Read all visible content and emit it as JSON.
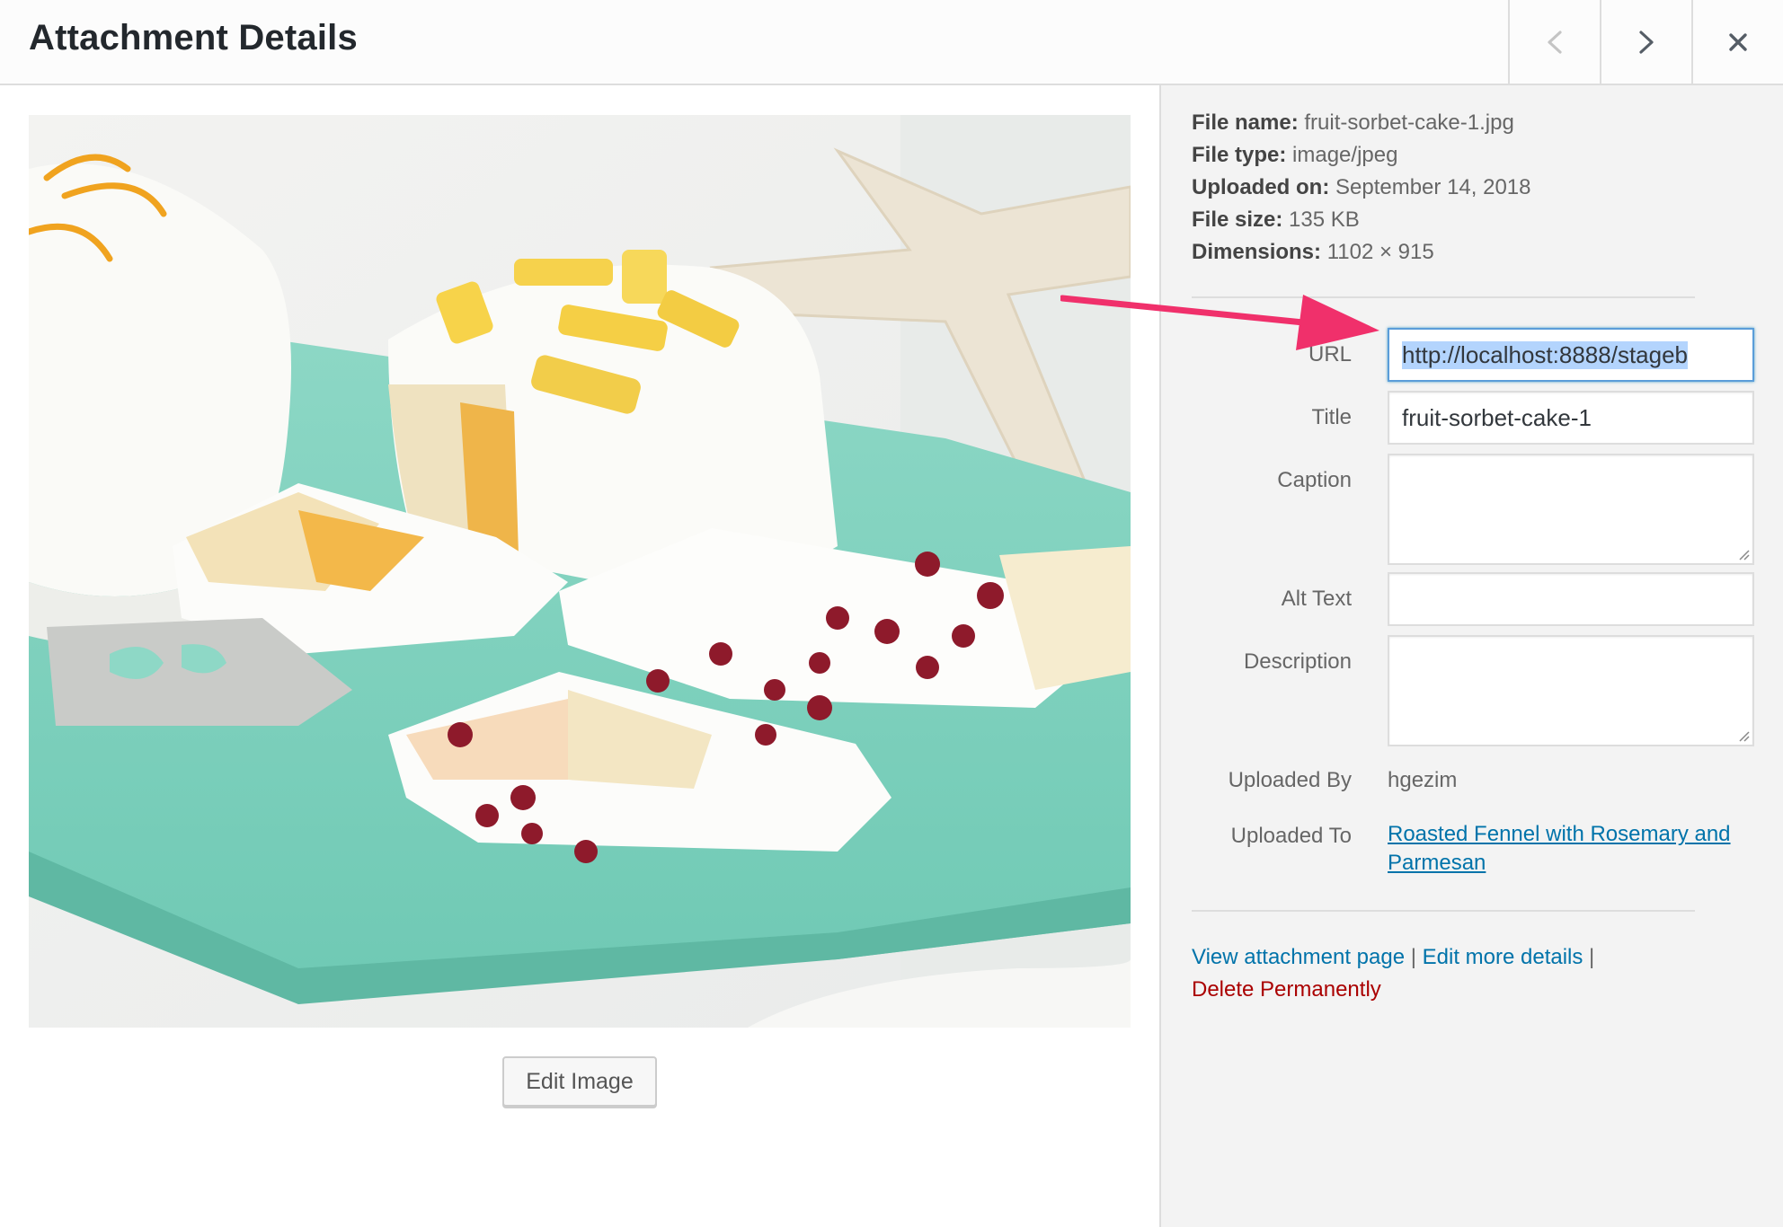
{
  "header": {
    "title": "Attachment Details",
    "prev_icon": "chevron-left-icon",
    "next_icon": "chevron-right-icon",
    "close_icon": "close-icon"
  },
  "media": {
    "edit_button_label": "Edit Image"
  },
  "file_info": [
    {
      "label": "File name:",
      "value": "fruit-sorbet-cake-1.jpg"
    },
    {
      "label": "File type:",
      "value": "image/jpeg"
    },
    {
      "label": "Uploaded on:",
      "value": "September 14, 2018"
    },
    {
      "label": "File size:",
      "value": "135 KB"
    },
    {
      "label": "Dimensions:",
      "value": "1102 × 915"
    }
  ],
  "fields": {
    "url": {
      "label": "URL",
      "value": "http://localhost:8888/stageb"
    },
    "title": {
      "label": "Title",
      "value": "fruit-sorbet-cake-1"
    },
    "caption": {
      "label": "Caption",
      "value": ""
    },
    "alt_text": {
      "label": "Alt Text",
      "value": ""
    },
    "description": {
      "label": "Description",
      "value": ""
    },
    "uploaded_by": {
      "label": "Uploaded By",
      "value": "hgezim"
    },
    "uploaded_to": {
      "label": "Uploaded To",
      "value": "Roasted Fennel with Rosemary and Parmesan"
    }
  },
  "actions": {
    "view": "View attachment page",
    "edit": "Edit more details",
    "separator": "|",
    "delete": "Delete Permanently"
  },
  "colors": {
    "link": "#0073aa",
    "delete": "#aa0000",
    "annotation_arrow": "#f0306b",
    "focus_border": "#5b9dd9"
  }
}
